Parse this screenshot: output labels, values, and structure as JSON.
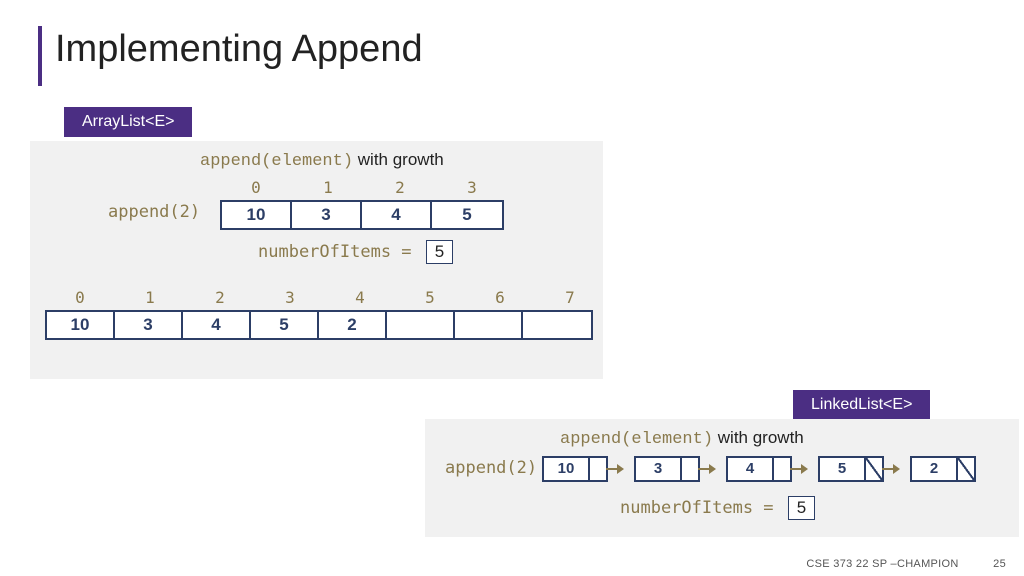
{
  "title": "Implementing Append",
  "labels": {
    "arraylist": "ArrayList<E>",
    "linkedlist": "LinkedList<E>"
  },
  "arraylist": {
    "caption_code": "append(element)",
    "caption_suffix": " with growth",
    "call": "append(2)",
    "small_indices": [
      "0",
      "1",
      "2",
      "3"
    ],
    "small_values": [
      "10",
      "3",
      "4",
      "5"
    ],
    "num_items_label": "numberOfItems = ",
    "num_items_value": "5",
    "big_indices": [
      "0",
      "1",
      "2",
      "3",
      "4",
      "5",
      "6",
      "7"
    ],
    "big_values": [
      "10",
      "3",
      "4",
      "5",
      "2",
      "",
      "",
      ""
    ]
  },
  "linkedlist": {
    "caption_code": "append(element)",
    "caption_suffix": " with growth",
    "call": "append(2)",
    "nodes": [
      "10",
      "3",
      "4",
      "5",
      "2"
    ],
    "num_items_label": "numberOfItems = ",
    "num_items_value": "5"
  },
  "footer": {
    "course": "CSE 373 22 SP –CHAMPION",
    "page": "25"
  }
}
